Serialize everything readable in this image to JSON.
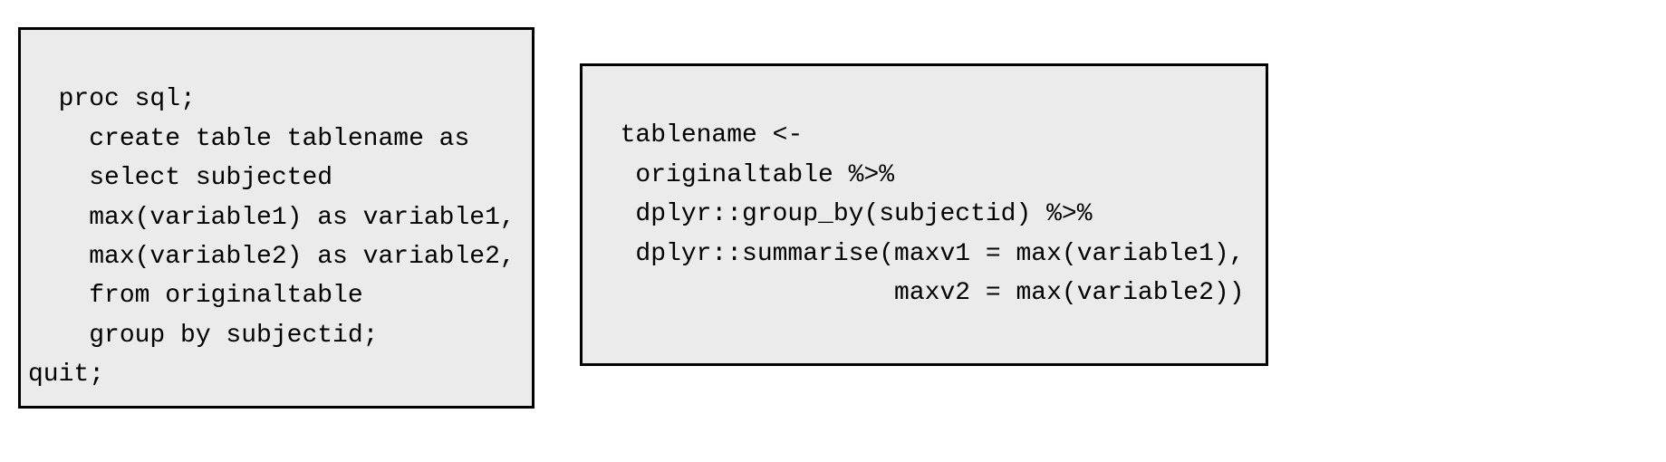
{
  "leftCode": "proc sql;\n    create table tablename as\n    select subjected\n    max(variable1) as variable1,\n    max(variable2) as variable2,\n    from originaltable\n    group by subjectid;\nquit;",
  "rightCode": "tablename <-\n   originaltable %>%\n   dplyr::group_by(subjectid) %>%\n   dplyr::summarise(maxv1 = max(variable1),\n                    maxv2 = max(variable2))\n"
}
